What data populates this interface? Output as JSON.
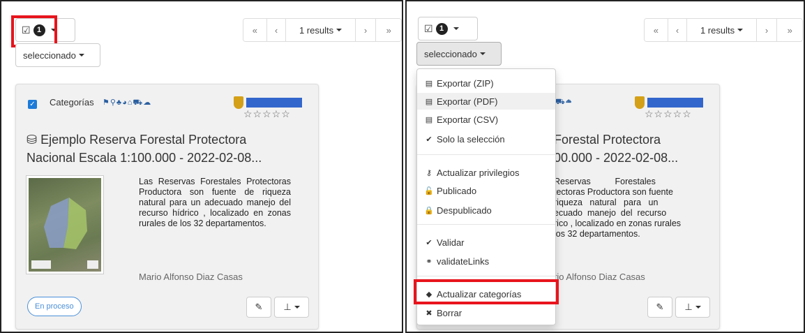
{
  "selection": {
    "count": "1",
    "check_icon": "checkbox-icon"
  },
  "seleccionado_label": "seleccionado",
  "pager": {
    "first": "«",
    "prev": "‹",
    "results_label": "1 results",
    "next": "›",
    "last": "»"
  },
  "card": {
    "categories_label": "Categorías",
    "category_icons": [
      "flag-icon",
      "map-marker-icon",
      "tree-icon",
      "globe-icon",
      "home-icon",
      "truck-icon",
      "cloud-icon"
    ],
    "category_glyphs": "⚑⚲♣◕⌂⛟☁",
    "title_line1": "Ejemplo Reserva Forestal Protectora",
    "title_line2": "Nacional Escala 1:100.000 - 2022-02-08...",
    "description": "Las Reservas Forestales Protectoras Productora son fuente de riqueza natural para un adecuado manejo del recurso hídrico , localizado en zonas rurales de los 32 departamentos.",
    "author": "Mario Alfonso Diaz Casas",
    "status": "En proceso",
    "rating_stars": "☆☆☆☆☆",
    "edit_icon": "✎",
    "pin_icon": "⊥"
  },
  "right_card": {
    "title_line1": "Forestal Protectora",
    "title_line2": "00.000 - 2022-02-08...",
    "desc_lines": [
      "Reservas          Forestales",
      "tectoras Productora son fuente",
      "riqueza   natural   para   un",
      "ecuado  manejo  del  recurso",
      "rico , localizado en zonas rurales",
      "los 32 departamentos."
    ],
    "author": "rio Alfonso Diaz Casas"
  },
  "dropdown": {
    "items": [
      {
        "label": "Exportar (ZIP)",
        "icon": "file-zip-icon",
        "glyph": "▤"
      },
      {
        "label": "Exportar (PDF)",
        "icon": "file-pdf-icon",
        "glyph": "▤"
      },
      {
        "label": "Exportar (CSV)",
        "icon": "file-csv-icon",
        "glyph": "▤"
      },
      {
        "label": "Solo la selección",
        "icon": "check-icon",
        "glyph": "✔"
      },
      {
        "label": "Actualizar privilegios",
        "icon": "key-icon",
        "glyph": "⚷"
      },
      {
        "label": "Publicado",
        "icon": "unlock-icon",
        "glyph": "🔓"
      },
      {
        "label": "Despublicado",
        "icon": "lock-icon",
        "glyph": "🔒"
      },
      {
        "label": "Validar",
        "icon": "check-icon",
        "glyph": "✔"
      },
      {
        "label": "validateLinks",
        "icon": "link-icon",
        "glyph": "⚭"
      },
      {
        "label": "Actualizar categorías",
        "icon": "tags-icon",
        "glyph": "◆"
      },
      {
        "label": "Borrar",
        "icon": "times-icon",
        "glyph": "✖"
      }
    ]
  },
  "highlight_color": "#e8141c"
}
